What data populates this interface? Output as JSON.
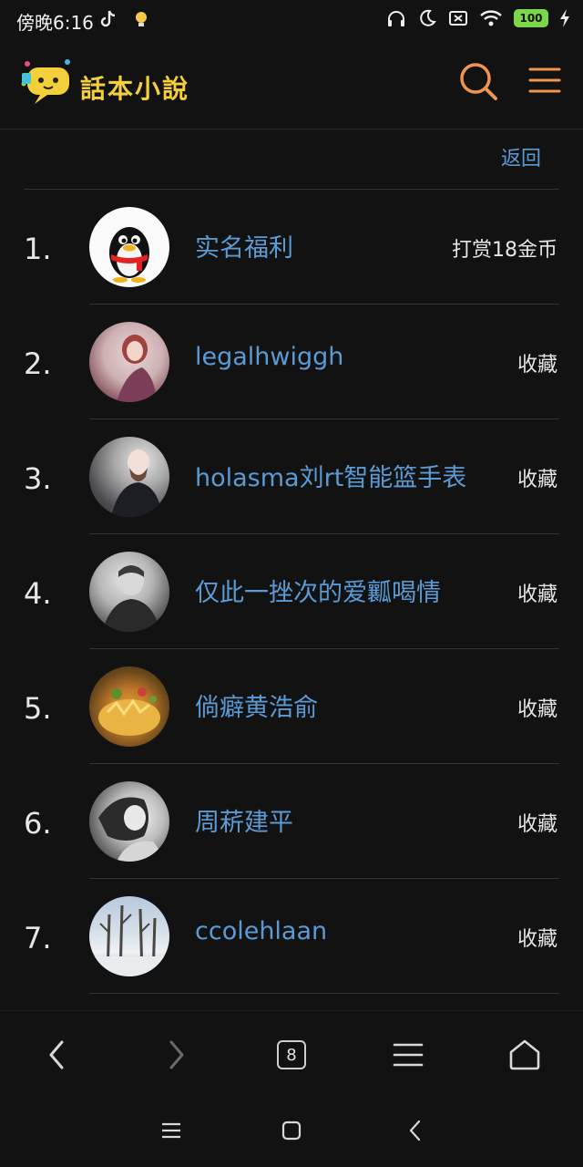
{
  "status_bar": {
    "time": "傍晚6:16",
    "battery": "100"
  },
  "header": {
    "logo_text": "話本小說",
    "search_icon": "search-icon",
    "menu_icon": "hamburger-menu-icon"
  },
  "back_label": "返回",
  "list": [
    {
      "rank": "1.",
      "name": "实名福利",
      "action": "打赏18金币",
      "avatar": "penguin"
    },
    {
      "rank": "2.",
      "name": "legalhwiggh",
      "action": "收藏",
      "avatar": "woman-pink"
    },
    {
      "rank": "3.",
      "name": "holasma刘rt智能篮手表",
      "action": "收藏",
      "avatar": "man-gray"
    },
    {
      "rank": "4.",
      "name": "仅此一挫次的爱瓤喝情",
      "action": "收藏",
      "avatar": "man-bw"
    },
    {
      "rank": "5.",
      "name": "倘癖黄浩俞",
      "action": "收藏",
      "avatar": "food"
    },
    {
      "rank": "6.",
      "name": "周菥建平",
      "action": "收藏",
      "avatar": "girl-bw"
    },
    {
      "rank": "7.",
      "name": "ccolehlaan",
      "action": "收藏",
      "avatar": "winter-trees"
    }
  ],
  "browser_bar": {
    "tab_count": "8"
  },
  "colors": {
    "background": "#121212",
    "link": "#5b9bd5",
    "accent": "#f0954f",
    "logo": "#f3cf3b"
  }
}
